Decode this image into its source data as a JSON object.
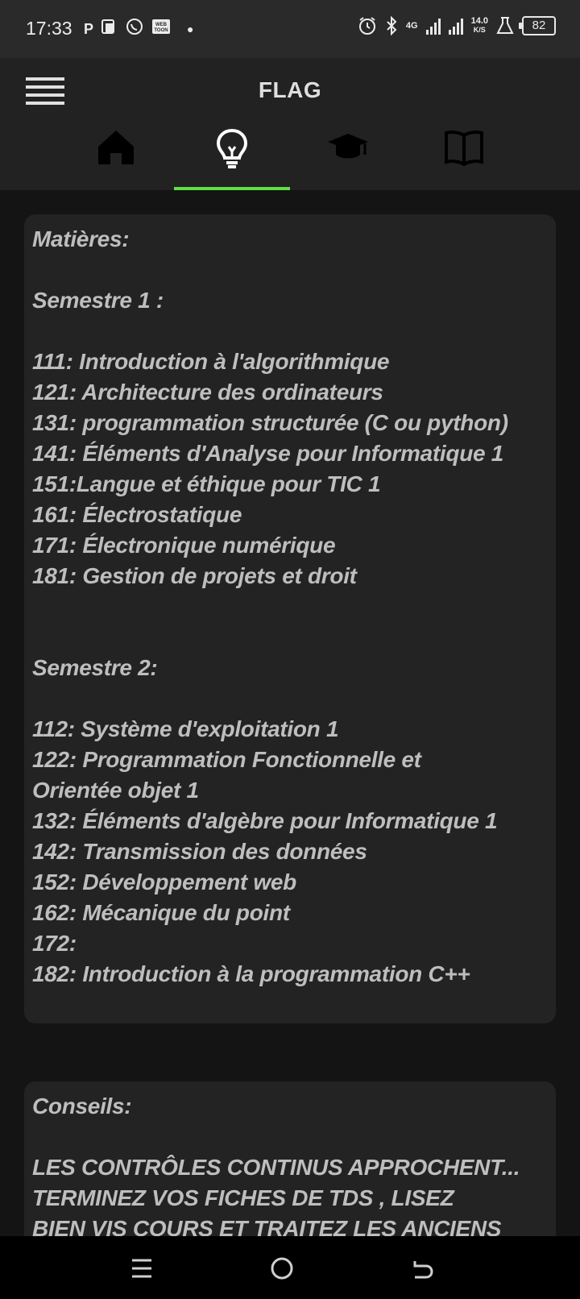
{
  "status_bar": {
    "time": "17:33",
    "left_icons": [
      "parking-icon",
      "app-icon",
      "whatsapp-icon",
      "webtoon-icon"
    ],
    "webtoon_label": "WEB TOON",
    "network_type": "4G",
    "net_speed_value": "14.0",
    "net_speed_unit": "K/S",
    "battery": "82"
  },
  "app_bar": {
    "title": "FLAG"
  },
  "tabs": [
    {
      "name": "home",
      "icon": "home-icon"
    },
    {
      "name": "ideas",
      "icon": "lightbulb-icon",
      "selected": true
    },
    {
      "name": "education",
      "icon": "graduation-cap-icon"
    },
    {
      "name": "courses",
      "icon": "book-icon"
    }
  ],
  "accent_color": "#62df45",
  "subjects_card": {
    "text": "Matières:\n\nSemestre 1 :\n\n111: Introduction à l'algorithmique\n121: Architecture des ordinateurs\n131: programmation structurée (C ou python)\n141: Éléments d'Analyse pour Informatique 1\n151:Langue et éthique pour TIC 1\n161: Électrostatique\n171: Électronique numérique\n181: Gestion de projets et droit\n\n\nSemestre 2:\n\n112: Système d'exploitation 1\n122: Programmation Fonctionnelle et\nOrientée objet 1\n132: Éléments d'algèbre pour Informatique 1\n142: Transmission des données\n152: Développement web\n162: Mécanique du point\n172:\n182: Introduction à la programmation C++"
  },
  "advice_card": {
    "text": "Conseils:\n\nLES CONTRÔLES CONTINUS APPROCHENT...\nTERMINEZ VOS FICHES DE TDS , LISEZ\nBIEN VIS COURS ET TRAITEZ LES ANCIENS"
  },
  "nav_bar": {
    "buttons": [
      "menu-icon",
      "home-circle-icon",
      "back-icon"
    ]
  }
}
